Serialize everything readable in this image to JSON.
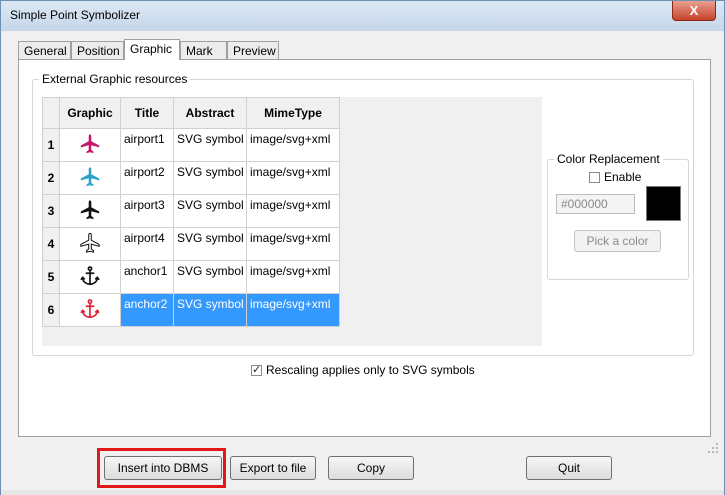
{
  "window": {
    "title": "Simple Point Symbolizer",
    "close_label": "X"
  },
  "tabs": [
    {
      "label": "General",
      "active": false
    },
    {
      "label": "Position",
      "active": false
    },
    {
      "label": "Graphic",
      "active": true
    },
    {
      "label": "Mark",
      "active": false
    },
    {
      "label": "Preview",
      "active": false
    }
  ],
  "external_graphics": {
    "legend": "External Graphic resources",
    "columns": [
      "Graphic",
      "Title",
      "Abstract",
      "MimeType"
    ],
    "rows": [
      {
        "num": "1",
        "icon": "airplane-icon",
        "color": "#c2186b",
        "title": "airport1",
        "abstract": "SVG symbol",
        "mime": "image/svg+xml"
      },
      {
        "num": "2",
        "icon": "airplane-icon",
        "color": "#2aa3c8",
        "title": "airport2",
        "abstract": "SVG symbol",
        "mime": "image/svg+xml"
      },
      {
        "num": "3",
        "icon": "airplane-icon",
        "color": "#111111",
        "title": "airport3",
        "abstract": "SVG symbol",
        "mime": "image/svg+xml"
      },
      {
        "num": "4",
        "icon": "airplane-outline-icon",
        "color": "#111111",
        "title": "airport4",
        "abstract": "SVG symbol",
        "mime": "image/svg+xml"
      },
      {
        "num": "5",
        "icon": "anchor-icon",
        "color": "#111111",
        "title": "anchor1",
        "abstract": "SVG symbol",
        "mime": "image/svg+xml"
      },
      {
        "num": "6",
        "icon": "anchor-icon",
        "color": "#e0203a",
        "title": "anchor2",
        "abstract": "SVG symbol",
        "mime": "image/svg+xml",
        "selected": true
      }
    ]
  },
  "color_replacement": {
    "legend": "Color Replacement",
    "enable_label": "Enable",
    "enabled": false,
    "hex_value": "#000000",
    "swatch_color": "#000000",
    "pick_label": "Pick a color"
  },
  "rescale": {
    "label": "Rescaling applies only to SVG symbols",
    "checked": true
  },
  "buttons": {
    "insert": "Insert into DBMS",
    "export": "Export to file",
    "copy": "Copy",
    "quit": "Quit"
  },
  "colors": {
    "selection": "#3399ff",
    "highlight_box": "#e01818"
  }
}
